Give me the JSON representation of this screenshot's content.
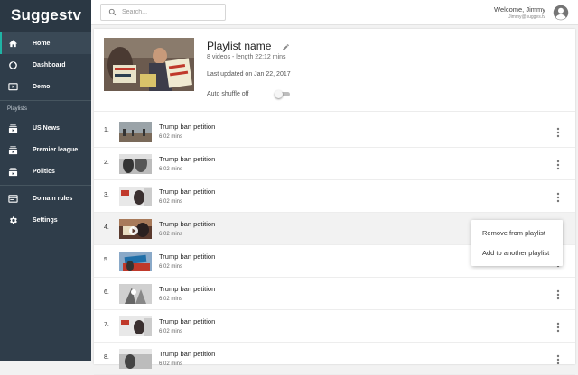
{
  "app": {
    "logo": "Suggestv"
  },
  "sidebar": {
    "items": [
      {
        "label": "Home",
        "icon": "home-icon",
        "active": true
      },
      {
        "label": "Dashboard",
        "icon": "dashboard-icon"
      },
      {
        "label": "Demo",
        "icon": "demo-icon"
      }
    ],
    "section_label": "Playlists",
    "playlists": [
      {
        "label": "US News",
        "icon": "playlist-icon"
      },
      {
        "label": "Premier league",
        "icon": "playlist-icon"
      },
      {
        "label": "Politics",
        "icon": "playlist-icon"
      }
    ],
    "bottom": [
      {
        "label": "Domain rules",
        "icon": "domain-rules-icon"
      },
      {
        "label": "Settings",
        "icon": "gear-icon"
      }
    ]
  },
  "header": {
    "search_placeholder": "Search...",
    "welcome": "Welcome, Jimmy",
    "email": "Jimmy@sugges.tv"
  },
  "playlist": {
    "name": "Playlist name",
    "meta": "8 videos - length 22:12 mins",
    "updated": "Last updated on Jan 22, 2017",
    "shuffle_label": "Auto shuffle off",
    "shuffle_on": false
  },
  "videos": [
    {
      "num": "1.",
      "title": "Trump ban petition",
      "length": "6:02 mins"
    },
    {
      "num": "2.",
      "title": "Trump ban petition",
      "length": "6:02 mins"
    },
    {
      "num": "3.",
      "title": "Trump ban petition",
      "length": "6:02 mins"
    },
    {
      "num": "4.",
      "title": "Trump ban petition",
      "length": "6:02 mins"
    },
    {
      "num": "5.",
      "title": "Trump ban petition",
      "length": "6:02 mins"
    },
    {
      "num": "6.",
      "title": "Trump ban petition",
      "length": "6:02 mins"
    },
    {
      "num": "7.",
      "title": "Trump ban petition",
      "length": "6:02 mins"
    },
    {
      "num": "8.",
      "title": "Trump ban petition",
      "length": "6:02 mins"
    }
  ],
  "context_menu": {
    "items": [
      "Remove from playlist",
      "Add to another playlist"
    ]
  },
  "colors": {
    "sidebar": "#2f3d4a",
    "accent": "#1fb4a5"
  }
}
